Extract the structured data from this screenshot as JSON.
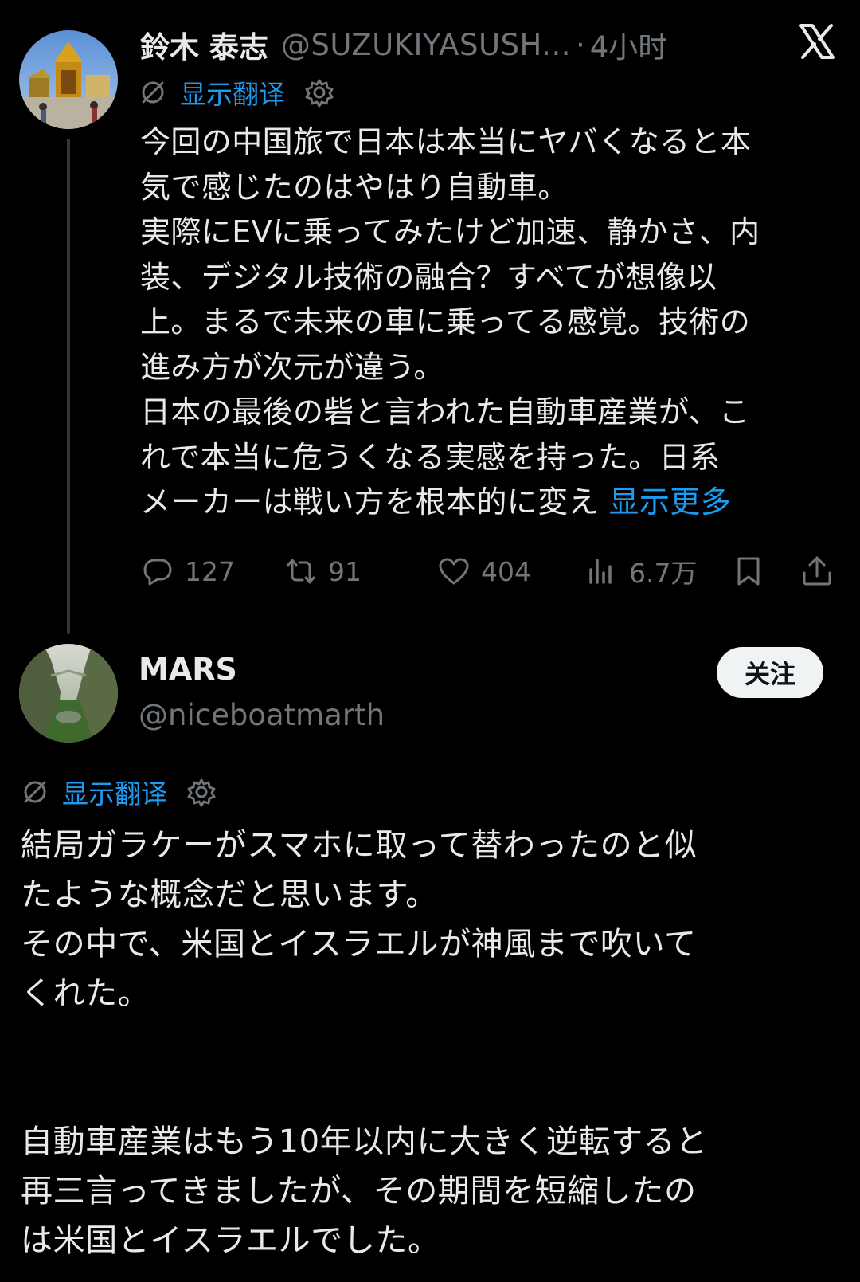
{
  "parent_tweet": {
    "display_name": "鈴木 泰志",
    "handle": "@SUZUKIYASUSH...",
    "separator": "·",
    "time": "4小时",
    "translate_label": "显示翻译",
    "text_lines": [
      "今回の中国旅で日本は本当にヤバくなると本",
      "気で感じたのはやはり自動車。",
      "実際にEVに乗ってみたけど加速、静かさ、内",
      "装、デジタル技術の融合？すべてが想像以",
      "上。まるで未来の車に乗ってる感覚。技術の",
      "進み方が次元が違う。",
      "日本の最後の砦と言われた自動車産業が、こ",
      "れで本当に危うくなる実感を持った。日系"
    ],
    "last_line": "メーカーは戦い方を根本的に変え",
    "show_more": "显示更多",
    "stats": {
      "replies": "127",
      "retweets": "91",
      "likes": "404",
      "views": "6.7万"
    }
  },
  "reply_tweet": {
    "display_name": "MARS",
    "handle": "@niceboatmarth",
    "follow_label": "关注",
    "translate_label": "显示翻译",
    "paragraph1_lines": [
      "結局ガラケーがスマホに取って替わったのと似",
      "たような概念だと思います。",
      "その中で、米国とイスラエルが神風まで吹いて",
      "くれた。"
    ],
    "paragraph2_lines": [
      "自動車産業はもう10年以内に大きく逆転すると",
      "再三言ってきましたが、その期間を短縮したの",
      "は米国とイスラエルでした。"
    ]
  },
  "icons": {
    "x_logo": "x-logo-icon",
    "translate": "globe-slash-icon",
    "settings": "gear-icon",
    "reply": "reply-icon",
    "retweet": "retweet-icon",
    "like": "heart-icon",
    "views": "views-icon",
    "bookmark": "bookmark-icon",
    "share": "share-icon"
  },
  "colors": {
    "background": "#000000",
    "text": "#e7e9ea",
    "muted": "#71767b",
    "link": "#1d9bf0",
    "thread_line": "#333639",
    "follow_bg": "#eff3f4"
  }
}
